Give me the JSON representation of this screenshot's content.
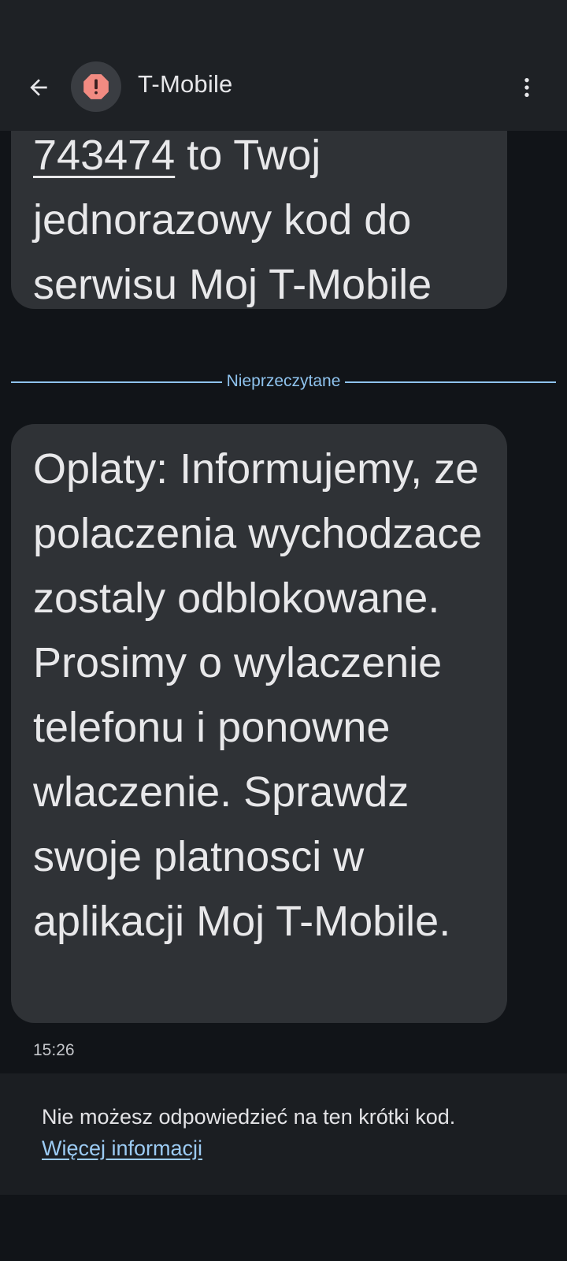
{
  "app_bar": {
    "title": "T-Mobile",
    "back_icon": "arrow-back-icon",
    "avatar_icon": "warning-icon",
    "menu_icon": "more-vertical-icon",
    "avatar_badge_color": "#f28b82"
  },
  "messages": [
    {
      "code": "743474",
      "text": " to Twoj jednorazowy kod do serwisu Moj T-Mobile"
    },
    {
      "text": "Oplaty: Informujemy, ze polaczenia wychodzace zostaly odblokowane. Prosimy o wylaczenie telefonu i ponowne wlaczenie. Sprawdz swoje platnosci w aplikacji Moj T-Mobile."
    }
  ],
  "divider": {
    "label": "Nieprzeczytane",
    "color": "#8fc3ee"
  },
  "timestamp": "15:26",
  "reply_info": {
    "text": "Nie możesz odpowiedzieć na ten krótki kod.",
    "link": "Więcej informacji"
  }
}
